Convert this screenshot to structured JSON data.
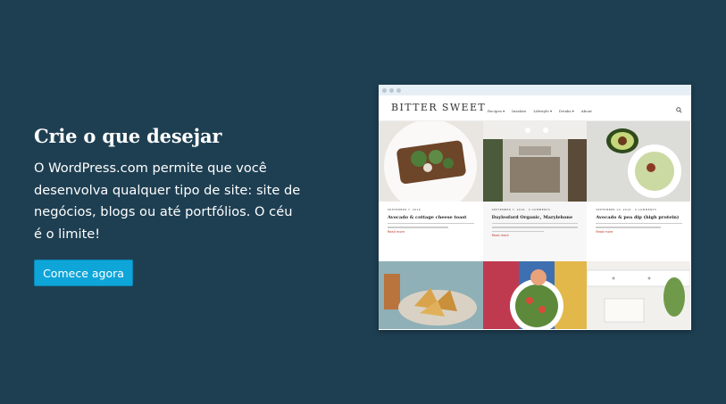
{
  "hero": {
    "title": "Crie o que desejar",
    "description": "O WordPress.com permite que você desenvolva qualquer tipo de site: site de negócios, blogs ou até portfólios. O céu é o limite!",
    "cta_label": "Comece agora"
  },
  "preview": {
    "site_name": "BITTER SWEET",
    "nav": [
      "Recipes ▾",
      "Insalate",
      "Lifestyle ▾",
      "Drinks ▾",
      "About"
    ],
    "search_icon": "search-icon",
    "posts": [
      {
        "meta": "SEPTEMBER 7, 2016",
        "title": "Avocado & cottage cheese toast",
        "more": "Read more"
      },
      {
        "meta": "SEPTEMBER 7, 2016 · 0 COMMENTS",
        "title": "Daylesford Organic, Marylebone",
        "more": "Read more"
      },
      {
        "meta": "SEPTEMBER 10, 2016 · 0 COMMENTS",
        "title": "Avocado & pea dip (high protein)",
        "more": "Read more"
      }
    ]
  },
  "colors": {
    "background": "#1e3f52",
    "cta": "#0ea5d9"
  }
}
